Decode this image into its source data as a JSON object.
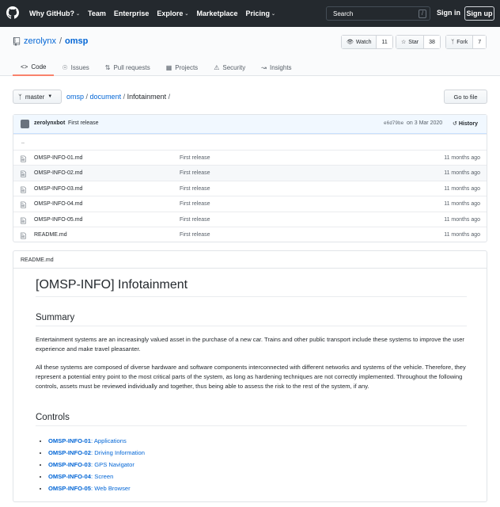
{
  "header": {
    "nav": [
      {
        "label": "Why GitHub?",
        "caret": true
      },
      {
        "label": "Team",
        "caret": false
      },
      {
        "label": "Enterprise",
        "caret": false
      },
      {
        "label": "Explore",
        "caret": true
      },
      {
        "label": "Marketplace",
        "caret": false
      },
      {
        "label": "Pricing",
        "caret": true
      }
    ],
    "search_placeholder": "Search",
    "search_key": "/",
    "signin": "Sign in",
    "signup": "Sign up"
  },
  "repo": {
    "owner": "zerolynx",
    "separator": "/",
    "name": "omsp",
    "watch": {
      "label": "Watch",
      "count": "11"
    },
    "star": {
      "label": "Star",
      "count": "38"
    },
    "fork": {
      "label": "Fork",
      "count": "7"
    },
    "tabs": [
      "Code",
      "Issues",
      "Pull requests",
      "Projects",
      "Security",
      "Insights"
    ]
  },
  "breadcrumb": {
    "branch": "master",
    "repo": "omsp",
    "folder": "document",
    "current": "Infotainment",
    "goto_file": "Go to file"
  },
  "commit": {
    "author": "zerolynxbot",
    "message": "First release",
    "sha": "e6d79be",
    "date": "on 3 Mar 2020",
    "history": "History"
  },
  "files": {
    "parent": "..",
    "rows": [
      {
        "name": "OMSP-INFO-01.md",
        "message": "First release",
        "age": "11 months ago"
      },
      {
        "name": "OMSP-INFO-02.md",
        "message": "First release",
        "age": "11 months ago"
      },
      {
        "name": "OMSP-INFO-03.md",
        "message": "First release",
        "age": "11 months ago"
      },
      {
        "name": "OMSP-INFO-04.md",
        "message": "First release",
        "age": "11 months ago"
      },
      {
        "name": "OMSP-INFO-05.md",
        "message": "First release",
        "age": "11 months ago"
      },
      {
        "name": "README.md",
        "message": "First release",
        "age": "11 months ago"
      }
    ]
  },
  "readme": {
    "filename": "README.md",
    "title": "[OMSP-INFO] Infotainment",
    "summary_heading": "Summary",
    "p1": "Entertainment systems are an increasingly valued asset in the purchase of a new car. Trains and other public transport include these systems to improve the user experience and make travel pleasanter.",
    "p2": "All these systems are composed of diverse hardware and software components interconnected with different networks and systems of the vehicle. Therefore, they represent a potential entry point to the most critical parts of the system, as long as hardening techniques are not correctly implemented. Throughout the following controls, assets must be reviewed individually and together, thus being able to assess the risk to the rest of the system, if any.",
    "controls_heading": "Controls",
    "controls": [
      {
        "id": "OMSP-INFO-01",
        "name": "Applications"
      },
      {
        "id": "OMSP-INFO-02",
        "name": "Driving Information"
      },
      {
        "id": "OMSP-INFO-03",
        "name": "GPS Navigator"
      },
      {
        "id": "OMSP-INFO-04",
        "name": "Screen"
      },
      {
        "id": "OMSP-INFO-05",
        "name": "Web Browser"
      }
    ]
  }
}
